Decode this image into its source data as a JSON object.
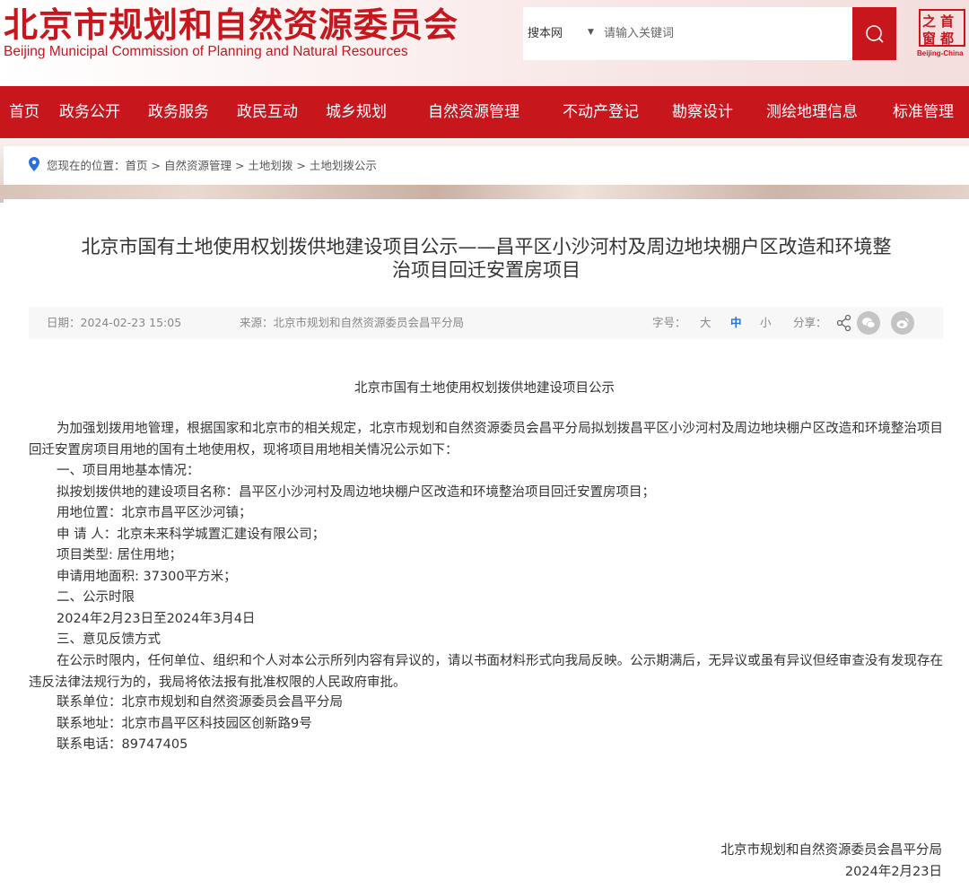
{
  "header": {
    "title": "北京市规划和自然资源委员会",
    "subtitle": "Beijing Municipal Commission of Planning and Natural Resources",
    "search": {
      "scope": "搜本网",
      "placeholder": "请输入关键词"
    },
    "badge": {
      "chars": [
        "之",
        "首",
        "窗",
        "都"
      ],
      "caption": "Beijing-China"
    }
  },
  "nav": {
    "items": [
      "首页",
      "政务公开",
      "政务服务",
      "政民互动",
      "城乡规划",
      "自然资源管理",
      "不动产登记",
      "勘察设计",
      "测绘地理信息",
      "标准管理"
    ]
  },
  "breadcrumb": {
    "prefix": "您现在的位置：",
    "items": [
      "首页",
      "自然资源管理",
      "土地划拨",
      "土地划拨公示"
    ],
    "separator": " > "
  },
  "article": {
    "title_line1": "北京市国有土地使用权划拨供地建设项目公示——昌平区小沙河村及周边地块棚户区改造和环境整",
    "title_line2": "治项目回迁安置房项目",
    "meta": {
      "date": "日期：2024-02-23 15:05",
      "source": "来源：北京市规划和自然资源委员会昌平分局",
      "font_label": "字号：",
      "font_sizes": [
        "大",
        "中",
        "小"
      ],
      "active_font": "中",
      "share_label": "分享："
    },
    "heading": "北京市国有土地使用权划拨供地建设项目公示",
    "intro": "为加强划拨用地管理，根据国家和北京市的相关规定，北京市规划和自然资源委员会昌平分局拟划拨昌平区小沙河村及周边地块棚户区改造和环境整治项目回迁安置房项目用地的国有土地使用权，现将项目用地相关情况公示如下：",
    "lines": [
      "一、项目用地基本情况：",
      "拟按划拨供地的建设项目名称：昌平区小沙河村及周边地块棚户区改造和环境整治项目回迁安置房项目；",
      "用地位置：北京市昌平区沙河镇；",
      "申 请 人：北京未来科学城置汇建设有限公司；",
      "项目类型: 居住用地；",
      "申请用地面积: 37300平方米；",
      "二、公示时限",
      "2024年2月23日至2024年3月4日",
      "三、意见反馈方式"
    ],
    "feedback": "在公示时限内，任何单位、组织和个人对本公示所列内容有异议的，请以书面材料形式向我局反映。公示期满后，无异议或虽有异议但经审查没有发现存在违反法律法规行为的，我局将依法报有批准权限的人民政府审批。",
    "contact": [
      "联系单位：北京市规划和自然资源委员会昌平分局",
      "联系地址：北京市昌平区科技园区创新路9号",
      "联系电话：89747405"
    ],
    "signature": {
      "org": "北京市规划和自然资源委员会昌平分局",
      "date": "2024年2月23日"
    }
  },
  "colors": {
    "brand": "#c8161d",
    "active_font": "#2a6fdb"
  }
}
